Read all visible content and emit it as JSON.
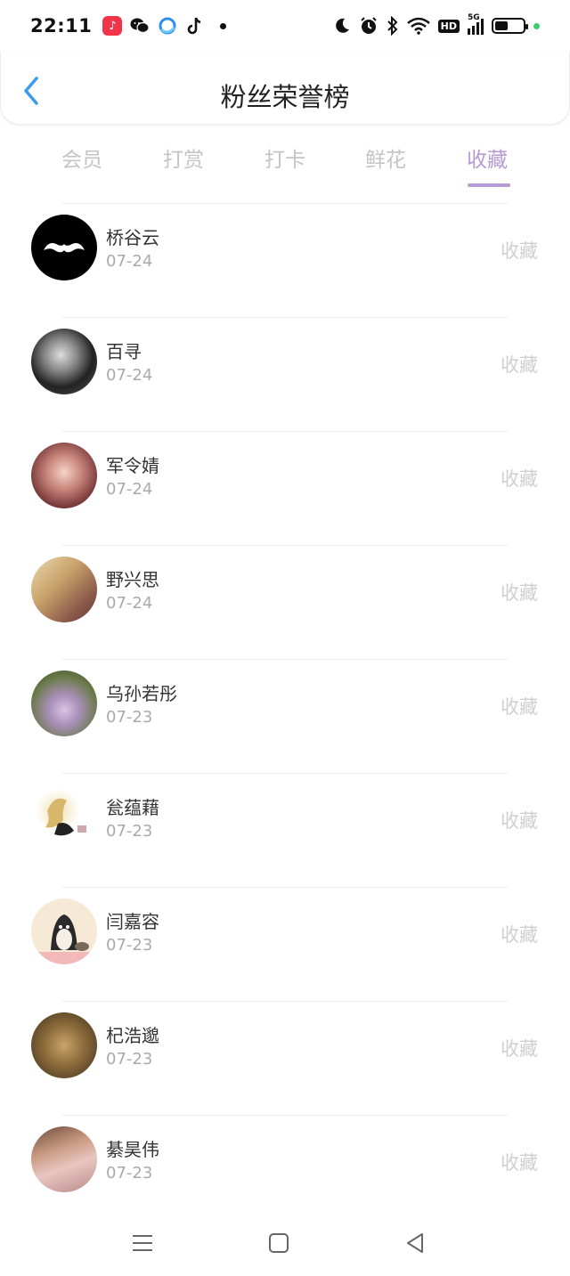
{
  "status_bar": {
    "time": "22:11",
    "network": "5G",
    "hd_label": "HD",
    "battery_level": 0.45,
    "accent_dot_color": "#3ccf6e"
  },
  "header": {
    "title": "粉丝荣誉榜",
    "back_icon": "chevron-left-icon",
    "accent_color": "#3d9be9"
  },
  "tabs": [
    {
      "label": "会员",
      "active": false
    },
    {
      "label": "打赏",
      "active": false
    },
    {
      "label": "打卡",
      "active": false
    },
    {
      "label": "鲜花",
      "active": false
    },
    {
      "label": "收藏",
      "active": true
    }
  ],
  "tab_active_color": "#b79ad6",
  "fans": [
    {
      "name": "桥谷云",
      "date": "07-24",
      "action": "收藏"
    },
    {
      "name": "百寻",
      "date": "07-24",
      "action": "收藏"
    },
    {
      "name": "军令婧",
      "date": "07-24",
      "action": "收藏"
    },
    {
      "name": "野兴思",
      "date": "07-24",
      "action": "收藏"
    },
    {
      "name": "乌孙若彤",
      "date": "07-23",
      "action": "收藏"
    },
    {
      "name": "瓮蕴藉",
      "date": "07-23",
      "action": "收藏"
    },
    {
      "name": "闫嘉容",
      "date": "07-23",
      "action": "收藏"
    },
    {
      "name": "杞浩邈",
      "date": "07-23",
      "action": "收藏"
    },
    {
      "name": "綦昊伟",
      "date": "07-23",
      "action": "收藏"
    }
  ],
  "nav_bar": {
    "menu_icon": "menu-icon",
    "home_icon": "home-square-icon",
    "back_icon": "back-triangle-icon"
  }
}
